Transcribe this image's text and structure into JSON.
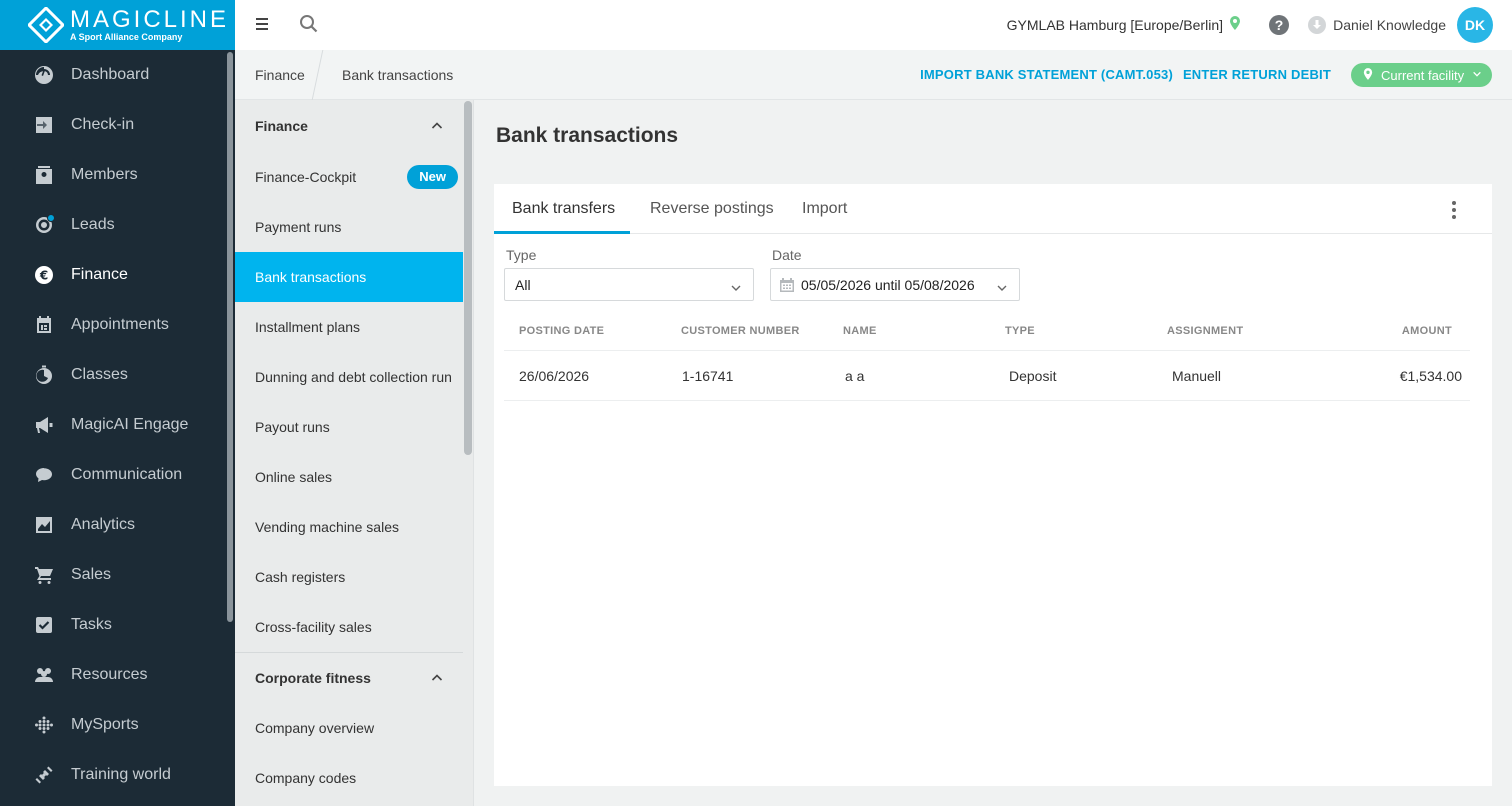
{
  "brand": {
    "name": "MAGICLINE",
    "tagline": "A Sport Alliance Company",
    "accent": "#00a1d8"
  },
  "leftnav": {
    "items": [
      {
        "label": "Dashboard",
        "icon": "dashboard-icon"
      },
      {
        "label": "Check-in",
        "icon": "checkin-icon"
      },
      {
        "label": "Members",
        "icon": "members-icon"
      },
      {
        "label": "Leads",
        "icon": "leads-icon"
      },
      {
        "label": "Finance",
        "icon": "euro-icon"
      },
      {
        "label": "Appointments",
        "icon": "calendar-icon"
      },
      {
        "label": "Classes",
        "icon": "stopwatch-icon"
      },
      {
        "label": "MagicAI Engage",
        "icon": "megaphone-icon"
      },
      {
        "label": "Communication",
        "icon": "chat-icon"
      },
      {
        "label": "Analytics",
        "icon": "chart-icon"
      },
      {
        "label": "Sales",
        "icon": "cart-icon"
      },
      {
        "label": "Tasks",
        "icon": "checkbox-icon"
      },
      {
        "label": "Resources",
        "icon": "people-icon"
      },
      {
        "label": "MySports",
        "icon": "dots-grid-icon"
      },
      {
        "label": "Training world",
        "icon": "dumbbell-icon"
      }
    ]
  },
  "topbar": {
    "facility": "GYMLAB Hamburg [Europe/Berlin]",
    "help": "?",
    "user_name": "Daniel Knowledge",
    "user_initials": "DK"
  },
  "breadcrumb": {
    "parent": "Finance",
    "current": "Bank transactions",
    "import_action": "IMPORT BANK STATEMENT (CAMT.053)",
    "return_debit_action": "ENTER RETURN DEBIT",
    "facility_filter": "Current facility"
  },
  "subnav": {
    "finance_section": "Finance",
    "finance_items": [
      {
        "label": "Finance-Cockpit",
        "badge": "New"
      },
      {
        "label": "Payment runs"
      },
      {
        "label": "Bank transactions"
      },
      {
        "label": "Installment plans"
      },
      {
        "label": "Dunning and debt collection run"
      },
      {
        "label": "Payout runs"
      },
      {
        "label": "Online sales"
      },
      {
        "label": "Vending machine sales"
      },
      {
        "label": "Cash registers"
      },
      {
        "label": "Cross-facility sales"
      }
    ],
    "corporate_section": "Corporate fitness",
    "corporate_items": [
      {
        "label": "Company overview"
      },
      {
        "label": "Company codes"
      }
    ]
  },
  "main": {
    "title": "Bank transactions",
    "tabs": [
      "Bank transfers",
      "Reverse postings",
      "Import"
    ],
    "filters": {
      "type_label": "Type",
      "type_value": "All",
      "date_label": "Date",
      "date_value": "05/05/2026 until 05/08/2026"
    },
    "table": {
      "headers": [
        "POSTING DATE",
        "CUSTOMER NUMBER",
        "NAME",
        "TYPE",
        "ASSIGNMENT",
        "AMOUNT"
      ],
      "rows": [
        [
          "26/06/2026",
          "1-16741",
          "a a",
          "Deposit",
          "Manuell",
          "€1,534.00"
        ]
      ]
    }
  }
}
